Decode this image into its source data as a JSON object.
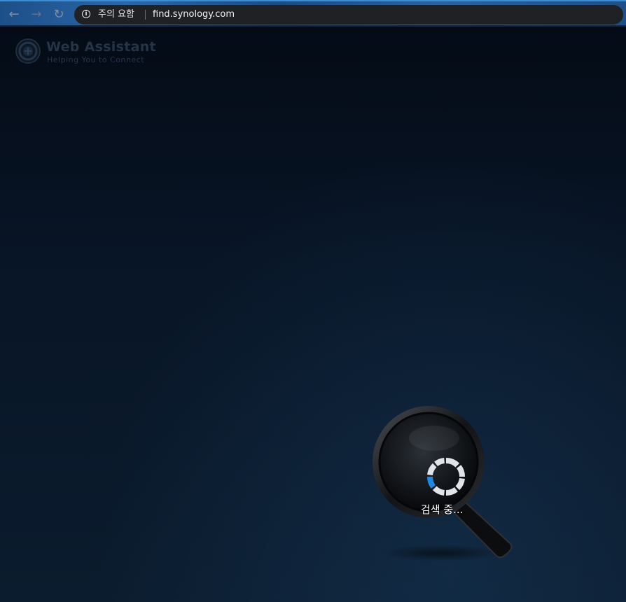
{
  "browser": {
    "security_label": "주의 요함",
    "url": "find.synology.com"
  },
  "logo": {
    "title": "Web Assistant",
    "subtitle": "Helping You to Connect"
  },
  "status": {
    "searching_label": "검색 중..."
  },
  "colors": {
    "spinner_active": "#1e88e5",
    "spinner_inactive": "#e0e3e7"
  }
}
